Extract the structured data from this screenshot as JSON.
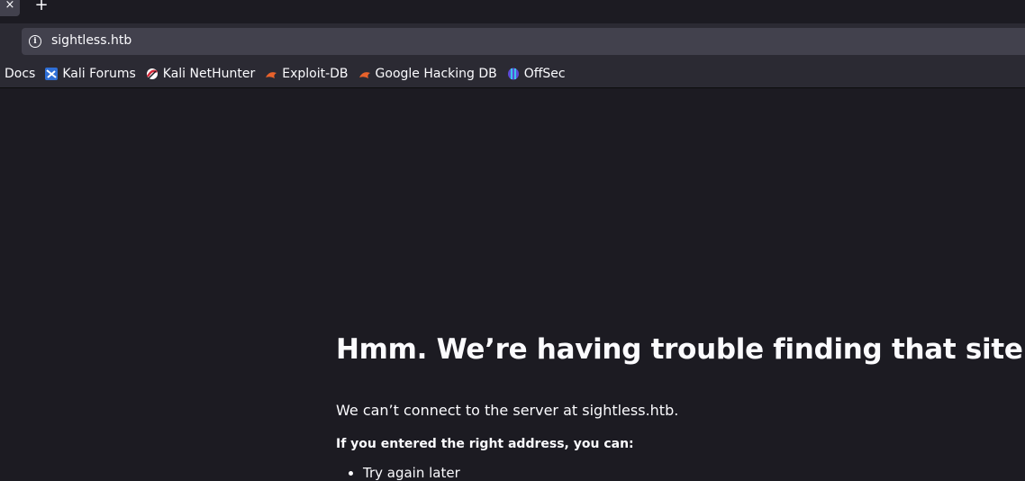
{
  "tabbar": {
    "close_glyph": "×",
    "new_tab_glyph": "+"
  },
  "urlbar": {
    "url": "sightless.htb",
    "info_icon": "info-icon"
  },
  "bookmarks": [
    {
      "label": "Docs",
      "icon": ""
    },
    {
      "label": "Kali Forums",
      "icon": "kali-forums-icon"
    },
    {
      "label": "Kali NetHunter",
      "icon": "kali-nethunter-icon"
    },
    {
      "label": "Exploit-DB",
      "icon": "exploit-db-icon"
    },
    {
      "label": "Google Hacking DB",
      "icon": "google-hacking-db-icon"
    },
    {
      "label": "OffSec",
      "icon": "offsec-icon"
    }
  ],
  "error": {
    "title": "Hmm. We’re having trouble finding that site.",
    "description": "We can’t connect to the server at sightless.htb.",
    "subheading": "If you entered the right address, you can:",
    "items": [
      "Try again later"
    ]
  },
  "colors": {
    "page_bg": "#1c1b22",
    "toolbar_bg": "#2b2a33",
    "urlbar_bg": "#42414d",
    "text": "#fbfbfe",
    "exploit_orange": "#e8622b",
    "kali_blue": "#2f6fd6"
  }
}
